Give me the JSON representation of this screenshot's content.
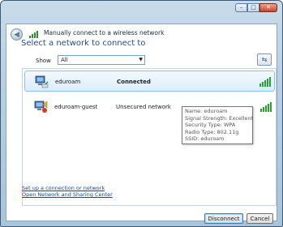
{
  "window": {
    "title": "Manually connect to a wireless network",
    "minimize_glyph": "–",
    "maximize_glyph": "□",
    "close_glyph": "✕",
    "back_glyph": "◀"
  },
  "heading": "Select a network to connect to",
  "filter": {
    "label": "Show",
    "selected": "All",
    "dropdown_glyph": "▼",
    "refresh_glyph": "⇆"
  },
  "networks": [
    {
      "name": "eduroam",
      "status": "Connected",
      "signal_bars": 5,
      "icon": "wireless-network-icon"
    },
    {
      "name": "eduroam-guest",
      "status": "Unsecured network",
      "signal_bars": 5,
      "icon": "unsecured-network-icon"
    }
  ],
  "tooltip": {
    "lines": [
      "Name: eduroam",
      "Signal Strength: Excellent",
      "Security Type: WPA",
      "Radio Type: 802.11g",
      "SSID: eduroam"
    ]
  },
  "links": {
    "setup": "Set up a connection or network",
    "open_center": "Open Network and Sharing Center"
  },
  "buttons": {
    "disconnect": "Disconnect",
    "cancel": "Cancel"
  },
  "colors": {
    "heading": "#1f4e96",
    "link": "#0d47b5",
    "signal": "#24a531",
    "selection": "#dcedfb"
  }
}
